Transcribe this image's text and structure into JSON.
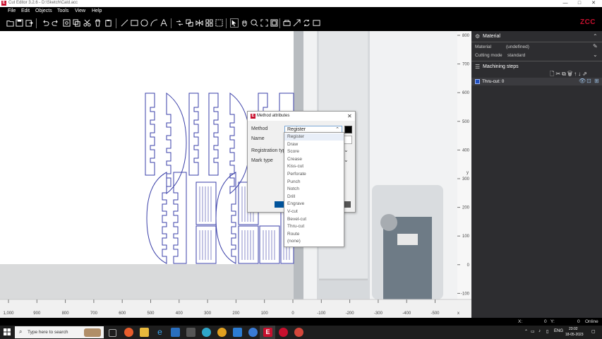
{
  "window": {
    "title": "Cut Editor 3.2.6  -  D:\\Sketch\\Cald.acc",
    "controls": [
      "—",
      "□",
      "✕"
    ]
  },
  "menu": [
    "File",
    "Edit",
    "Objects",
    "Tools",
    "View",
    "Help"
  ],
  "logo": {
    "text": "ZCC",
    "accent": "#c8102e"
  },
  "rulers": {
    "x_labels": [
      "1,000",
      "900",
      "800",
      "700",
      "600",
      "500",
      "400",
      "300",
      "200",
      "100",
      "0",
      "-100",
      "-200",
      "-300",
      "-400",
      "-500"
    ],
    "y_labels": [
      "800",
      "700",
      "600",
      "500",
      "400",
      "300",
      "200",
      "100",
      "0",
      "-100"
    ],
    "x_axis": "x",
    "y_axis": "y"
  },
  "dialog": {
    "title": "Method attributes",
    "method_label": "Method",
    "method_value": "Register",
    "name_label": "Name",
    "registration_label": "Registration type",
    "mark_type_label": "Mark type",
    "color": "#000000"
  },
  "dropdown_options": [
    "Register",
    "Draw",
    "Score",
    "Crease",
    "Kiss-cut",
    "Perforate",
    "Punch",
    "Notch",
    "Drill",
    "Engrave",
    "V-cut",
    "Bevel-cut",
    "Thru-cut",
    "Route",
    "(none)"
  ],
  "panel": {
    "material_title": "Material",
    "material_label": "Material",
    "material_value": "(undefined)",
    "cutting_mode_label": "Cutting mode",
    "cutting_mode_value": "standard",
    "steps_title": "Machining steps",
    "steps": [
      {
        "name": "Thru-cut: 0",
        "color": "#1f4fbf"
      }
    ]
  },
  "status": {
    "x_label": "X:",
    "x_value": "0",
    "y_label": "Y:",
    "y_value": "0",
    "connection": "Online"
  },
  "taskbar": {
    "search_placeholder": "Type here to search",
    "language": "ENG",
    "time": "23:02",
    "date": "18-05-2023"
  }
}
